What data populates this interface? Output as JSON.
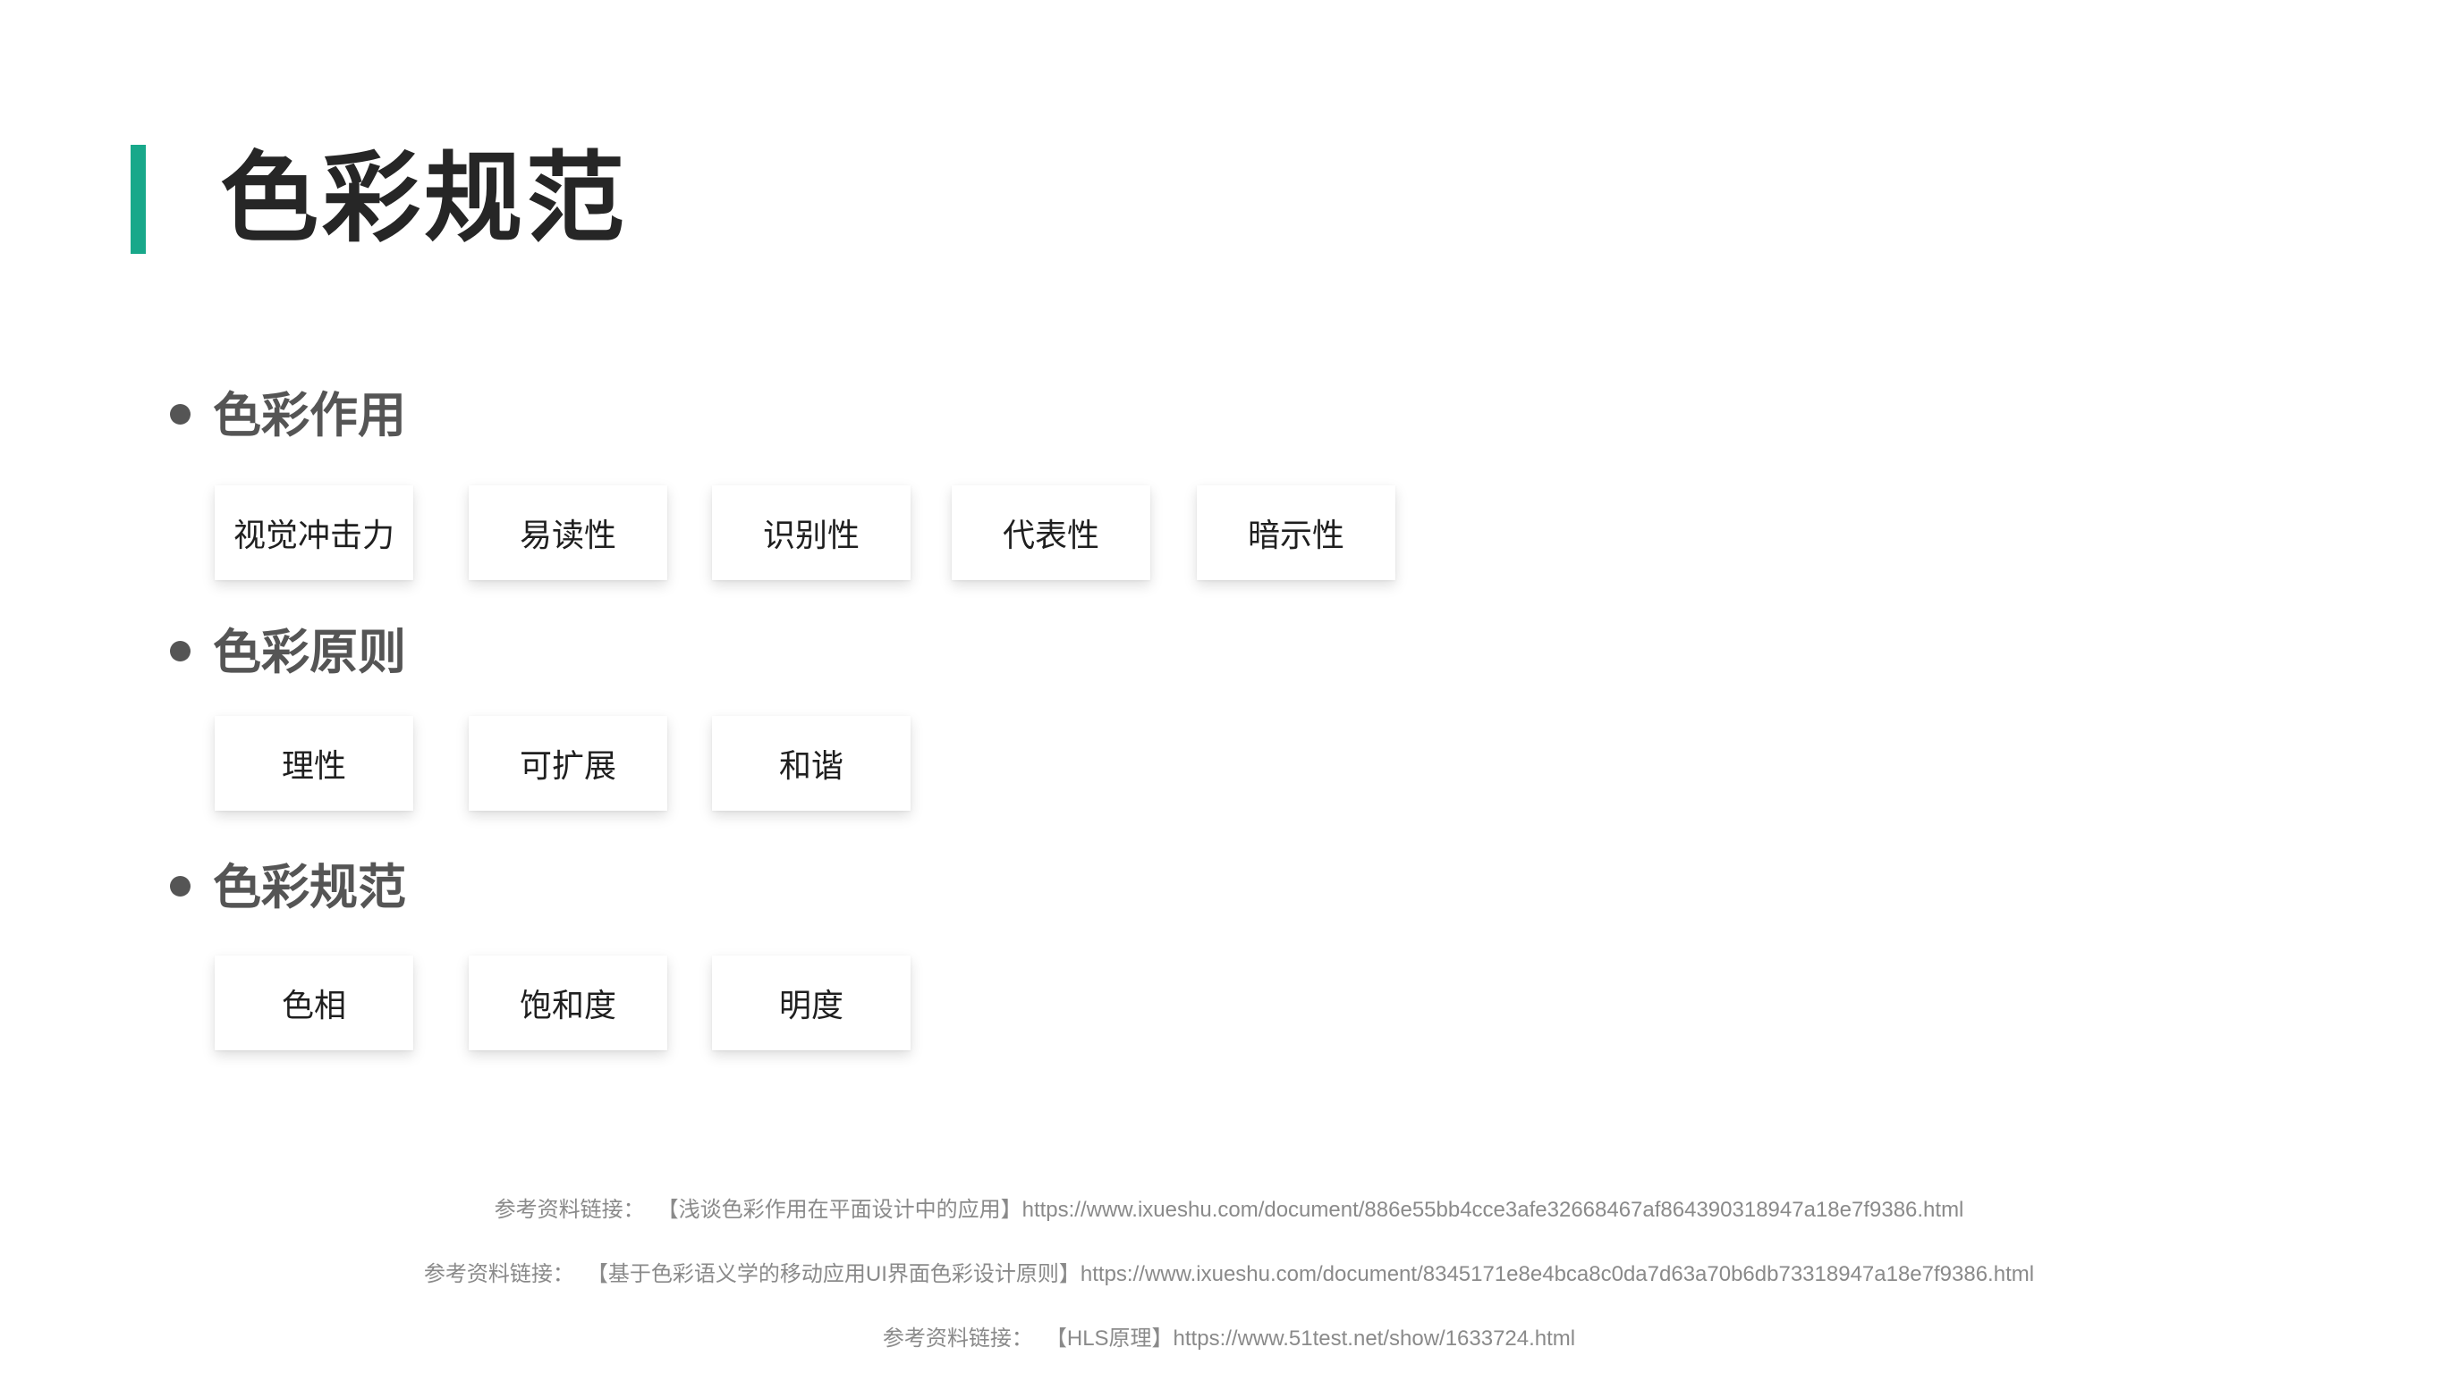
{
  "title": "色彩规范",
  "sections": [
    {
      "heading": "色彩作用",
      "items": [
        "视觉冲击力",
        "易读性",
        "识别性",
        "代表性",
        "暗示性"
      ]
    },
    {
      "heading": "色彩原则",
      "items": [
        "理性",
        "可扩展",
        "和谐"
      ]
    },
    {
      "heading": "色彩规范",
      "items": [
        "色相",
        "饱和度",
        "明度"
      ]
    }
  ],
  "references": [
    {
      "label": "参考资料链接：",
      "text": "【浅谈色彩作用在平面设计中的应用】https://www.ixueshu.com/document/886e55bb4cce3afe32668467af864390318947a18e7f9386.html"
    },
    {
      "label": "参考资料链接：",
      "text": "【基于色彩语义学的移动应用UI界面色彩设计原则】https://www.ixueshu.com/document/8345171e8e4bca8c0da7d63a70b6db73318947a18e7f9386.html"
    },
    {
      "label": "参考资料链接：",
      "text": "【HLS原理】https://www.51test.net/show/1633724.html"
    }
  ],
  "colors": {
    "accent": "#18a88a",
    "title": "#262626",
    "heading": "#555555",
    "reference": "#8a8a8a"
  }
}
